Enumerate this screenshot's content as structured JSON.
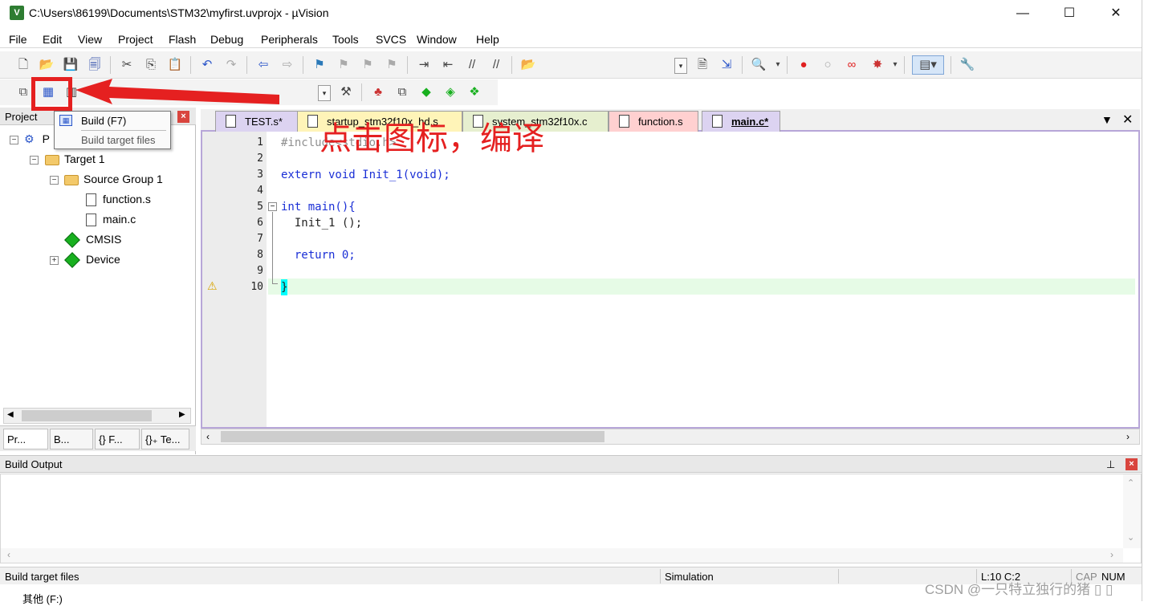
{
  "window": {
    "title": "C:\\Users\\86199\\Documents\\STM32\\myfirst.uvprojx - µVision",
    "app_icon": "uv-icon",
    "minimize": "—",
    "maximize": "☐",
    "close": "✕"
  },
  "menu": [
    {
      "label": "File"
    },
    {
      "label": "Edit"
    },
    {
      "label": "View"
    },
    {
      "label": "Project"
    },
    {
      "label": "Flash"
    },
    {
      "label": "Debug"
    },
    {
      "label": "Peripherals"
    },
    {
      "label": "Tools"
    },
    {
      "label": "SVCS"
    },
    {
      "label": "Window"
    },
    {
      "label": "Help"
    }
  ],
  "project_panel": {
    "title": "Project",
    "close": "×",
    "root_label": "P",
    "target": "Target 1",
    "group": "Source Group 1",
    "files": [
      "function.s",
      "main.c"
    ],
    "cmsis": "CMSIS",
    "device": "Device",
    "tabs": [
      "Pr...",
      "B...",
      "{} F...",
      "{}₊ Te..."
    ]
  },
  "tooltip": {
    "title": "Build (F7)",
    "description": "Build target files"
  },
  "annotation": {
    "text": "点击图标，编译",
    "color": "#e52020"
  },
  "editor": {
    "tabs": [
      {
        "label": "TEST.s*",
        "color": "#dcd3f1"
      },
      {
        "label": "startup_stm32f10x_hd.s",
        "color": "#fff4b8"
      },
      {
        "label": "system_stm32f10x.c",
        "color": "#e6efcf"
      },
      {
        "label": "function.s",
        "color": "#ffd0d0"
      },
      {
        "label": "main.c*",
        "color": "#dcd3f1"
      }
    ],
    "lines": [
      {
        "n": "1",
        "code": "#include<stdio.h>"
      },
      {
        "n": "2",
        "code": ""
      },
      {
        "n": "3",
        "code": "extern void Init_1(void);"
      },
      {
        "n": "4",
        "code": ""
      },
      {
        "n": "5",
        "code": "int main(){"
      },
      {
        "n": "6",
        "code": "  Init_1 ();"
      },
      {
        "n": "7",
        "code": ""
      },
      {
        "n": "8",
        "code": "  return 0;"
      },
      {
        "n": "9",
        "code": ""
      },
      {
        "n": "10",
        "code": "}"
      }
    ],
    "current_line": "10"
  },
  "build_output": {
    "title": "Build Output",
    "pin": "⊥",
    "close": "×"
  },
  "status": {
    "message": "Build target files",
    "mode": "Simulation",
    "position": "L:10 C:2",
    "caps": "CAP",
    "num": "NUM"
  },
  "taskbar_text": "其他 (F:)",
  "watermark": "CSDN @一只特立独行的猪 ▯ ▯"
}
